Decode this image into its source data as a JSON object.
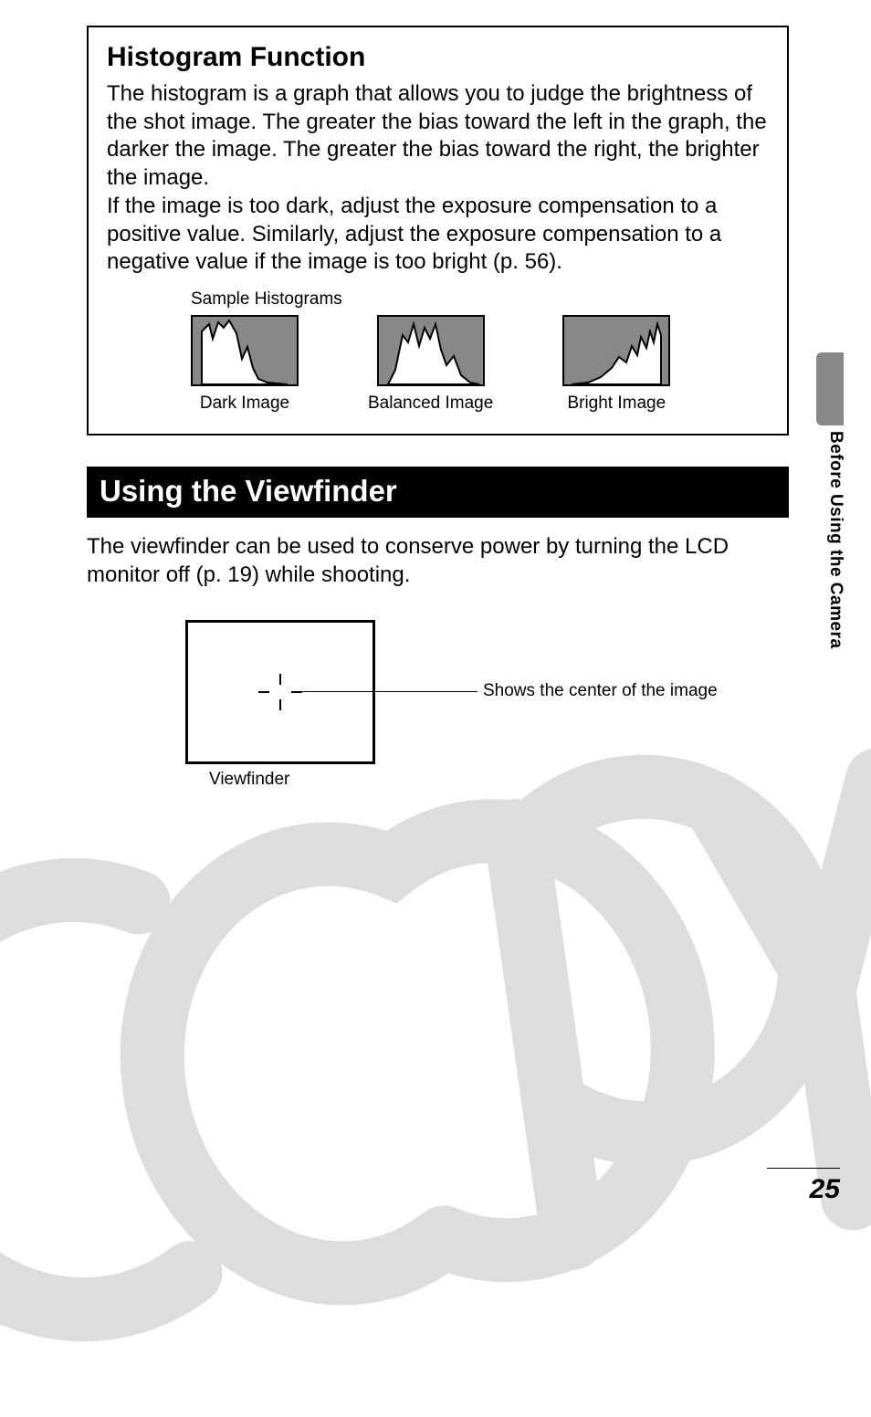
{
  "box": {
    "title": "Histogram Function",
    "paragraph1": "The histogram is a graph that allows you to judge the brightness of the shot image. The greater the bias toward the left in the graph, the darker the image. The greater the bias toward the right, the brighter the image.",
    "paragraph2": "If the image is too dark, adjust the exposure compensation to a positive value. Similarly, adjust the exposure compensation to a negative value if the image is too bright (p. 56).",
    "sample_label": "Sample Histograms",
    "histograms": [
      {
        "caption": "Dark Image",
        "icon": "histogram-dark-icon"
      },
      {
        "caption": "Balanced Image",
        "icon": "histogram-balanced-icon"
      },
      {
        "caption": "Bright Image",
        "icon": "histogram-bright-icon"
      }
    ]
  },
  "section": {
    "heading": "Using the Viewfinder",
    "body": "The viewfinder can be used to conserve power by turning the LCD monitor off (p. 19) while shooting.",
    "viewfinder_caption": "Viewfinder",
    "center_label": "Shows the center of the image"
  },
  "side": {
    "section_label": "Before Using the Camera"
  },
  "page_number": "25"
}
